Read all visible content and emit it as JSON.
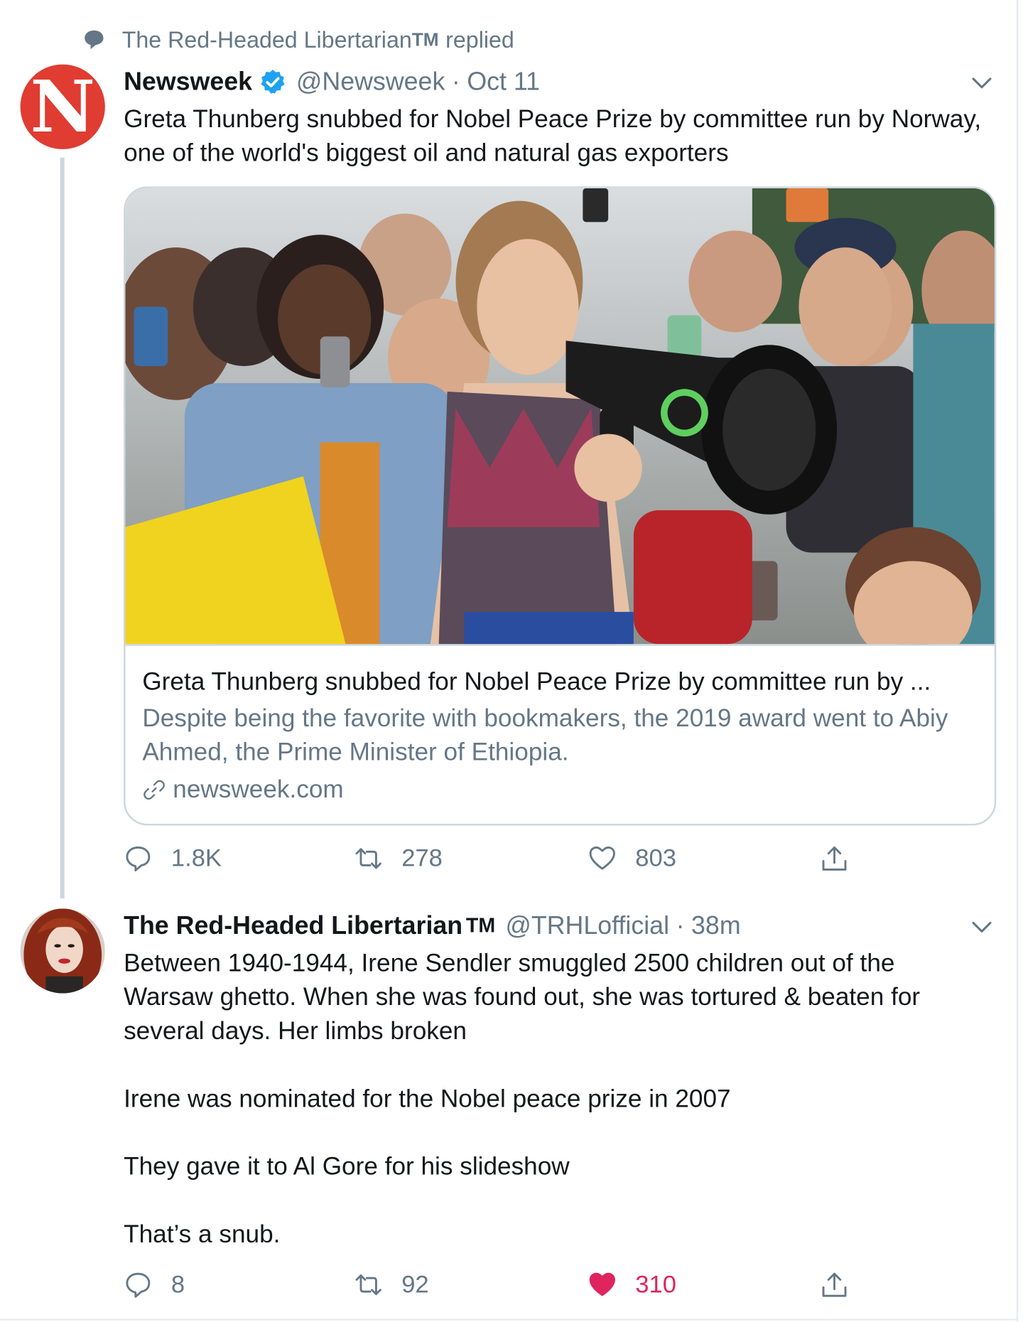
{
  "context": {
    "name": "The Red-Headed Libertarian",
    "tm": "TM",
    "verb": "replied"
  },
  "tweet1": {
    "avatar_letter": "N",
    "name": "Newsweek",
    "handle": "@Newsweek",
    "separator": "·",
    "time": "Oct 11",
    "text": "Greta Thunberg snubbed for Nobel Peace Prize by committee run by Norway, one of the world's biggest oil and natural gas exporters",
    "card": {
      "title": "Greta Thunberg snubbed for Nobel Peace Prize by committee run by ...",
      "description": "Despite being the favorite with bookmakers, the 2019 award went to Abiy Ahmed, the Prime Minister of Ethiopia.",
      "domain": "newsweek.com"
    },
    "actions": {
      "replies": "1.8K",
      "retweets": "278",
      "likes": "803"
    }
  },
  "tweet2": {
    "name": "The Red-Headed Libertarian",
    "tm": "TM",
    "handle": "@TRHLofficial",
    "separator": "·",
    "time": "38m",
    "paragraphs": [
      "Between 1940-1944, Irene Sendler smuggled 2500 children out of the Warsaw ghetto. When she was found out, she was tortured & beaten for several days. Her limbs broken",
      "Irene was nominated for the Nobel peace prize in 2007",
      "They gave it to Al Gore for his slideshow",
      "That’s a snub."
    ],
    "actions": {
      "replies": "8",
      "retweets": "92",
      "likes": "310"
    }
  },
  "colors": {
    "text_primary": "#14171a",
    "text_secondary": "#657786",
    "border": "#ccd6dd",
    "verified": "#1da1f2",
    "like_active": "#e0245e",
    "newsweek_red": "#e03c31"
  },
  "icons": {
    "context": "speech-bubble-icon",
    "verified": "verified-badge-icon",
    "menu": "chevron-down-icon",
    "link": "link-icon",
    "reply": "reply-icon",
    "retweet": "retweet-icon",
    "like": "heart-icon",
    "share": "share-icon"
  }
}
